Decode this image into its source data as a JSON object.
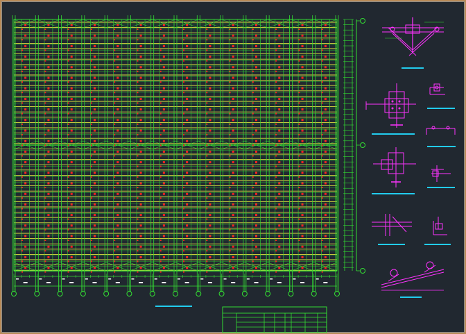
{
  "window": {
    "background_color": "#212830",
    "frame_color": "#b98a56"
  },
  "plan": {
    "grid_labels_x": [
      "1",
      "2",
      "3",
      "4",
      "5",
      "6",
      "7",
      "8",
      "9",
      "10",
      "11",
      "12",
      "13",
      "14",
      "15"
    ],
    "grid_labels_y": [
      "A",
      "B",
      "C"
    ],
    "colors": {
      "grid": "#33dd33",
      "purlin": "#ffff44",
      "brace": "#ff2222",
      "dimension": "#ffffff",
      "detail": "#ff33ff",
      "underline": "#22ccee"
    }
  },
  "details": [
    {
      "name": "ridge-connection-detail"
    },
    {
      "name": "column-base-detail-1"
    },
    {
      "name": "purlin-section-1"
    },
    {
      "name": "purlin-section-2"
    },
    {
      "name": "column-base-detail-2"
    },
    {
      "name": "purlin-clip-detail"
    },
    {
      "name": "brace-connection-detail"
    },
    {
      "name": "eave-detail"
    },
    {
      "name": "roof-slope-detail"
    }
  ],
  "title_block": {
    "line_color": "#33dd33"
  }
}
